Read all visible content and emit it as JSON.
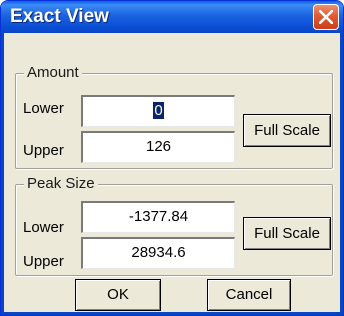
{
  "window": {
    "title": "Exact View"
  },
  "amount": {
    "group_title": "Amount",
    "lower_label": "Lower",
    "lower_value": "0",
    "upper_label": "Upper",
    "upper_value": "126",
    "full_scale_label": "Full Scale"
  },
  "peak_size": {
    "group_title": "Peak Size",
    "lower_label": "Lower",
    "lower_value": "-1377.84",
    "upper_label": "Upper",
    "upper_value": "28934.6",
    "full_scale_label": "Full Scale"
  },
  "buttons": {
    "ok_label": "OK",
    "cancel_label": "Cancel"
  },
  "icons": {
    "close": "close-icon"
  },
  "colors": {
    "title_bar": "#0b4fd6",
    "close_button": "#e05a34",
    "dialog_bg": "#ece9d8"
  }
}
